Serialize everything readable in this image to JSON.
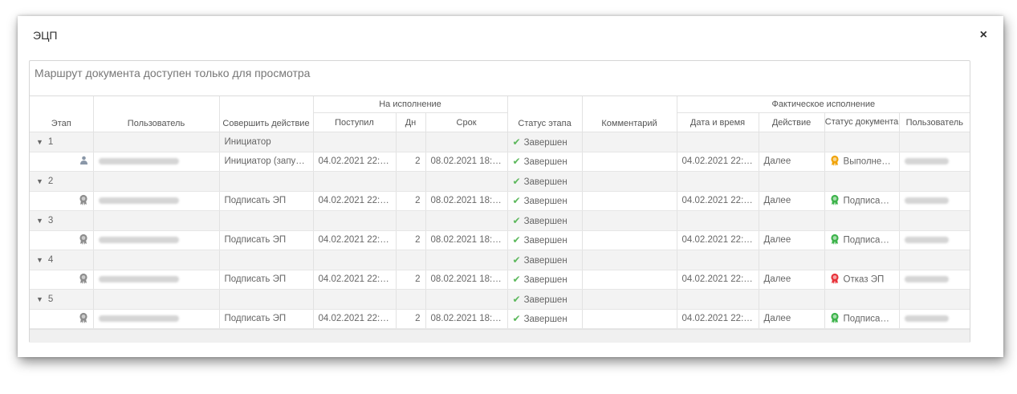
{
  "dialog": {
    "title": "ЭЦП",
    "close_label": "×"
  },
  "notice": "Маршрут документа доступен только для просмотра",
  "headers": {
    "stage": "Этап",
    "user": "Пользователь",
    "action": "Совершить действие",
    "execution_group": "На исполнение",
    "received": "Поступил",
    "days": "Дн",
    "deadline": "Срок",
    "stage_status": "Статус этапа",
    "comment": "Комментарий",
    "actual_group": "Фактическое исполнение",
    "datetime": "Дата и время",
    "act": "Действие",
    "doc_status": "Статус документа",
    "act_user": "Пользователь"
  },
  "groups": [
    {
      "stage": "1",
      "action": "Инициатор",
      "status": "Завершен",
      "row": {
        "icon": "user-icon",
        "action": "Инициатор (запу…",
        "received": "04.02.2021 22:…",
        "days": "2",
        "deadline": "08.02.2021 18:…",
        "status": "Завершен",
        "datetime": "04.02.2021 22:…",
        "act": "Далее",
        "doc_status": "Выполне…",
        "doc_status_color": "#f0a30a"
      }
    },
    {
      "stage": "2",
      "action": "",
      "status": "Завершен",
      "row": {
        "icon": "certificate-icon",
        "action": "Подписать ЭП",
        "received": "04.02.2021 22:…",
        "days": "2",
        "deadline": "08.02.2021 18:…",
        "status": "Завершен",
        "datetime": "04.02.2021 22:…",
        "act": "Далее",
        "doc_status": "Подписа…",
        "doc_status_color": "#3cb34a"
      }
    },
    {
      "stage": "3",
      "action": "",
      "status": "Завершен",
      "row": {
        "icon": "certificate-icon",
        "action": "Подписать ЭП",
        "received": "04.02.2021 22:…",
        "days": "2",
        "deadline": "08.02.2021 18:…",
        "status": "Завершен",
        "datetime": "04.02.2021 22:…",
        "act": "Далее",
        "doc_status": "Подписа…",
        "doc_status_color": "#3cb34a"
      }
    },
    {
      "stage": "4",
      "action": "",
      "status": "Завершен",
      "row": {
        "icon": "certificate-icon",
        "action": "Подписать ЭП",
        "received": "04.02.2021 22:…",
        "days": "2",
        "deadline": "08.02.2021 18:…",
        "status": "Завершен",
        "datetime": "04.02.2021 22:…",
        "act": "Далее",
        "doc_status": "Отказ ЭП",
        "doc_status_color": "#e8333a"
      }
    },
    {
      "stage": "5",
      "action": "",
      "status": "Завершен",
      "row": {
        "icon": "certificate-icon",
        "action": "Подписать ЭП",
        "received": "04.02.2021 22:…",
        "days": "2",
        "deadline": "08.02.2021 18:…",
        "status": "Завершен",
        "datetime": "04.02.2021 22:…",
        "act": "Далее",
        "doc_status": "Подписа…",
        "doc_status_color": "#3cb34a"
      }
    }
  ]
}
